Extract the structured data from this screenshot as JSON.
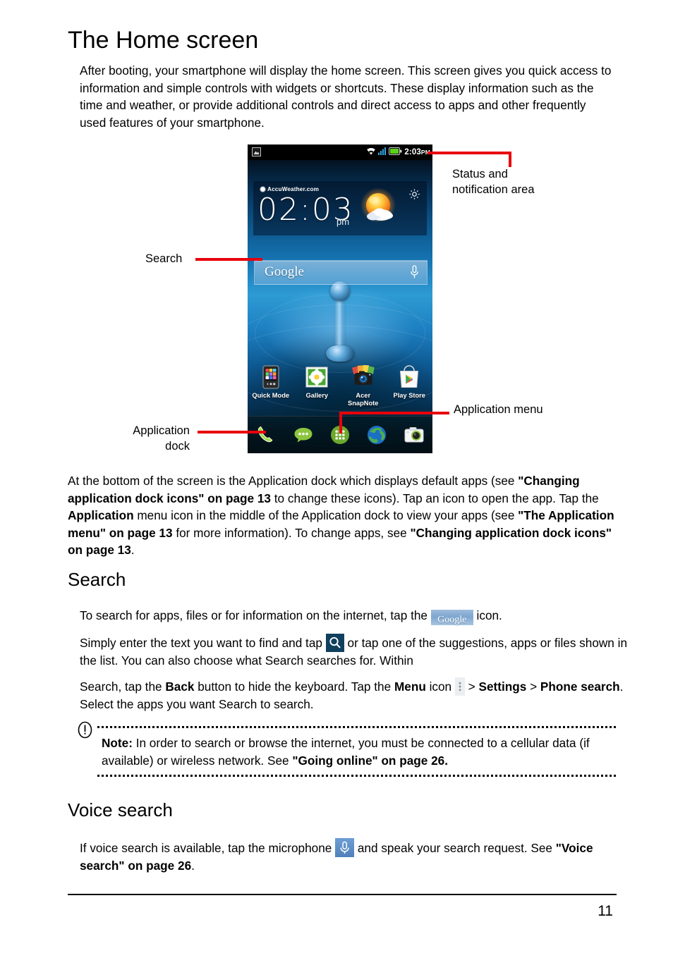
{
  "page": {
    "title": "The Home screen",
    "number": "11"
  },
  "intro": {
    "paragraph": "After booting, your smartphone will display the home screen. This screen gives you quick access to information and simple controls with widgets or shortcuts. These display information such as the time and weather, or provide additional controls and direct access to apps and other frequently used features of your smartphone."
  },
  "figure": {
    "callouts": {
      "status": "Status and\nnotification area",
      "status_line1": "Status and",
      "status_line2": "notification area",
      "search": "Search",
      "application_menu": "Application menu",
      "application_dock_line1": "Application",
      "application_dock_line2": "dock"
    },
    "phone": {
      "statusbar": {
        "time": "2:03",
        "ampm": "PM",
        "icons": [
          "image-notification-icon",
          "wifi-icon",
          "signal-bars-icon",
          "battery-icon"
        ]
      },
      "weather_widget": {
        "brand": "AccuWeather.com",
        "clock": "02:03",
        "ampm": "pm",
        "weather_icon": "sun-behind-cloud-icon",
        "settings_icon": "gear-icon"
      },
      "search_widget": {
        "label": "Google",
        "mic_icon": "microphone-icon"
      },
      "apps": [
        {
          "label": "Quick Mode",
          "icon": "quick-mode-icon"
        },
        {
          "label": "Gallery",
          "icon": "gallery-icon"
        },
        {
          "label": "Acer\nSnapNote",
          "label_line1": "Acer",
          "label_line2": "SnapNote",
          "icon": "acer-snapnote-icon"
        },
        {
          "label": "Play Store",
          "icon": "play-store-icon"
        }
      ],
      "dock": [
        {
          "name": "phone-icon"
        },
        {
          "name": "messaging-icon"
        },
        {
          "name": "application-menu-icon"
        },
        {
          "name": "browser-icon"
        },
        {
          "name": "camera-icon"
        }
      ]
    }
  },
  "dock_paragraph": {
    "p1": "At the bottom of the screen is the Application dock which displays default apps (see ",
    "b1": "\"Changing application dock icons\" on page 13",
    "p2": " to change these icons). Tap an icon to open the app. Tap the ",
    "b2": "Application",
    "p3": " menu icon in the middle of the Application dock to view your apps (see ",
    "b3": "\"The Application menu\" on page 13",
    "p4": " for more information). To change apps, see ",
    "b4": "\"Changing application dock icons\" on page 13",
    "p5": "."
  },
  "search_section": {
    "heading": "Search",
    "p1_a": "To search for apps, files or for information on the internet, tap the ",
    "p1_icon_label": "Google",
    "p1_b": " icon.",
    "p2_a": "Simply enter the text you want to find and tap ",
    "p2_icon": "search-magnifier-icon",
    "p2_b": " or tap one of the suggestions, apps or files shown in the list. You can also choose what Search searches for. Within",
    "p3_a": "Search, tap the ",
    "p3_b1": "Back",
    "p3_b": " button to hide the keyboard. Tap the ",
    "p3_b2": "Menu",
    "p3_c": " icon ",
    "p3_icon": "overflow-menu-icon",
    "p3_d": " > ",
    "p3_b3": "Settings",
    "p3_e": " > ",
    "p3_b4": "Phone search",
    "p3_f": ". Select the apps you want Search to search."
  },
  "note": {
    "icon": "exclamation-circle-icon",
    "label": "Note:",
    "text_a": " In order to search or browse the internet, you must be connected to a cellular data (if available) or wireless network. See ",
    "bold_ref": "\"Going online\" on page 26.",
    "text_b": ""
  },
  "voice_section": {
    "heading": "Voice search",
    "p1_a": "If voice search is available, tap the microphone ",
    "p1_icon": "microphone-icon",
    "p1_b": " and speak your search request. See ",
    "p1_bold": "\"Voice search\" on page 26",
    "p1_c": "."
  },
  "colors": {
    "leader_red": "#e8000b",
    "chip_blue_dark": "#11405e",
    "chip_blue_mid": "#5f8fc7",
    "battery_green": "#5bd21a",
    "signal_blue": "#3aa7e0"
  }
}
